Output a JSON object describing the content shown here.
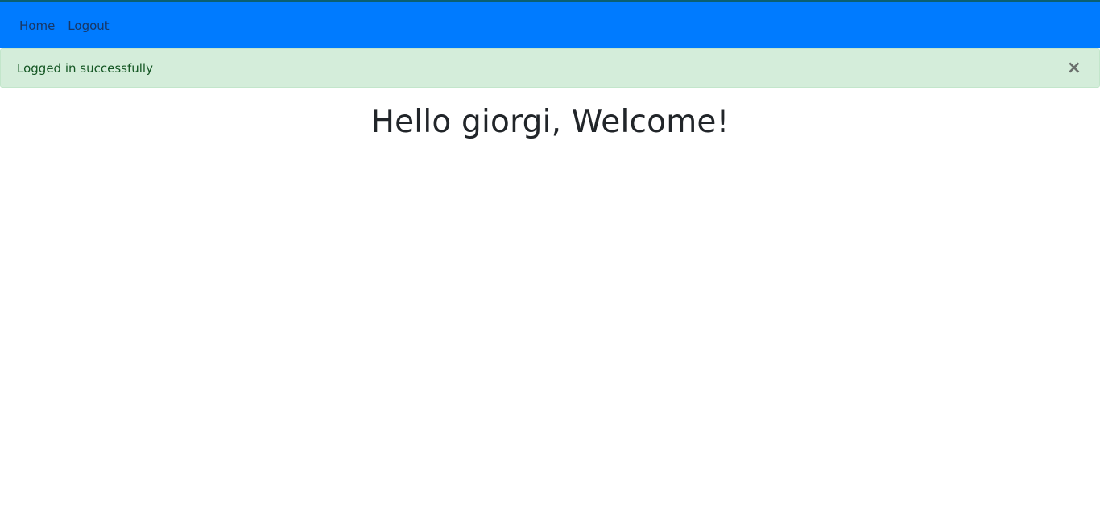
{
  "navbar": {
    "links": [
      {
        "label": "Home"
      },
      {
        "label": "Logout"
      }
    ],
    "background_color": "#007bff"
  },
  "alert": {
    "message": "Logged in successfully",
    "close_symbol": "×",
    "background_color": "#d4edda",
    "text_color": "#155724"
  },
  "main": {
    "heading": "Hello giorgi, Welcome!"
  }
}
